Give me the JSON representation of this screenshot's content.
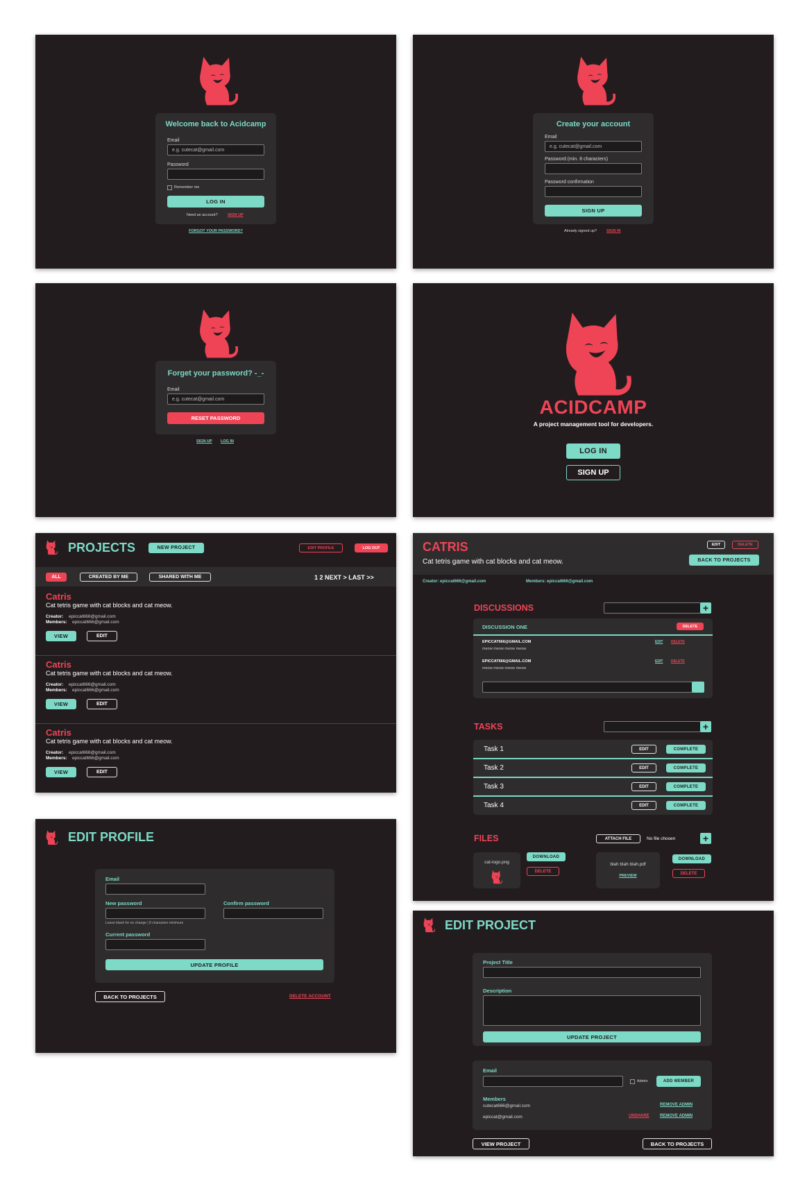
{
  "brand": {
    "name": "ACIDCAMP",
    "tagline": "A project management tool for developers.",
    "logo_icon": "cat-icon",
    "colors": {
      "accent_mint": "#7ddac6",
      "accent_red": "#ef4456",
      "background": "#231c1f",
      "card": "#2e2c2d"
    }
  },
  "login": {
    "title": "Welcome back to Acidcamp",
    "email_label": "Email",
    "email_placeholder": "e.g. cutecat@gmail.com",
    "password_label": "Password",
    "remember_label": "Remember me",
    "submit": "LOG IN",
    "need_account": "Need an account?",
    "signup_link": "SIGN UP",
    "forgot_link": "FORGOT YOUR PASSWORD?"
  },
  "signup": {
    "title": "Create your account",
    "email_label": "Email",
    "email_placeholder": "e.g. cutecat@gmail.com",
    "password_label": "Password (min. 8 characters)",
    "confirm_label": "Password confirmation",
    "submit": "SIGN UP",
    "already": "Already signed up?",
    "signin_link": "SIGN IN"
  },
  "forgot": {
    "title": "Forget your password? -_-",
    "email_label": "Email",
    "email_placeholder": "e.g. cutecat@gmail.com",
    "submit": "RESET PASSWORD",
    "signup_link": "SIGN UP",
    "login_link": "LOG IN"
  },
  "landing": {
    "login": "LOG IN",
    "signup": "SIGN UP"
  },
  "projects": {
    "title": "PROJECTS",
    "new_project": "NEW PROJECT",
    "edit_profile": "EDIT PROFILE",
    "log_out": "LOG OUT",
    "filters": [
      "ALL",
      "CREATED BY ME",
      "SHARED WITH ME"
    ],
    "pagination": "1 2 NEXT > LAST >>",
    "creator_label": "Creator:",
    "members_label": "Members:",
    "view_label": "VIEW",
    "edit_label": "EDIT",
    "items": [
      {
        "name": "Catris",
        "description": "Cat tetris game with cat blocks and cat meow.",
        "creator": "epiccat666@gmail.com",
        "members": "epiccat666@gmail.com"
      },
      {
        "name": "Catris",
        "description": "Cat tetris game with cat blocks and cat meow.",
        "creator": "epiccat666@gmail.com",
        "members": "epiccat666@gmail.com"
      },
      {
        "name": "Catris",
        "description": "Cat tetris game with cat blocks and cat meow.",
        "creator": "epiccat666@gmail.com",
        "members": "epiccat666@gmail.com"
      }
    ]
  },
  "edit_profile": {
    "title": "EDIT PROFILE",
    "email_label": "Email",
    "new_password_label": "New password",
    "confirm_password_label": "Confirm password",
    "hint": "Leave blank for no change  |  8 characters minimum",
    "current_password_label": "Current password",
    "submit": "UPDATE PROFILE",
    "back": "BACK TO PROJECTS",
    "delete": "DELETE ACCOUNT"
  },
  "project_detail": {
    "title": "CATRIS",
    "description": "Cat tetris game with cat blocks and cat meow.",
    "edit": "EDIT",
    "delete": "DELETE",
    "back": "BACK TO PROJECTS",
    "creator": "Creator: epiccat666@gmail.com",
    "members": "Members: epiccat666@gmail.com",
    "discussions_title": "DISCUSSIONS",
    "discussion": {
      "name": "DISCUSSION ONE",
      "delete": "DELETE",
      "messages": [
        {
          "author": "EPICCAT666@GMAIL.COM",
          "body": "meow meow meow meow",
          "edit": "EDIT",
          "delete": "DELETE"
        },
        {
          "author": "EPICCAT666@GMAIL.COM",
          "body": "meow meow meow meow",
          "edit": "EDIT",
          "delete": "DELETE"
        }
      ]
    },
    "tasks_title": "TASKS",
    "task_edit": "EDIT",
    "task_complete": "COMPLETE",
    "tasks": [
      "Task 1",
      "Task 2",
      "Task 3",
      "Task 4"
    ],
    "files_title": "FILES",
    "attach_file": "ATTACH FILE",
    "no_file": "No file chosen",
    "files": [
      {
        "name": "cat-logo.png",
        "download": "DOWNLOAD",
        "delete": "DELETE"
      },
      {
        "name": "blah blah blah.pdf",
        "preview": "PREVIEW",
        "download": "DOWNLOAD",
        "delete": "DELETE"
      }
    ]
  },
  "edit_project": {
    "title": "EDIT PROJECT",
    "project_title_label": "Project Title",
    "description_label": "Description",
    "submit": "UPDATE PROJECT",
    "email_label": "Email",
    "admin_label": "Admin",
    "add_member": "ADD MEMBER",
    "members_label": "Members",
    "members": [
      {
        "email": "cutecat666@gmail.com",
        "action": "REMOVE ADMIN"
      },
      {
        "email": "epiccat@gmail.com",
        "unshare": "UNSHARE",
        "action": "REMOVE ADMIN"
      }
    ],
    "view_project": "VIEW PROJECT",
    "back": "BACK TO PROJECTS"
  }
}
